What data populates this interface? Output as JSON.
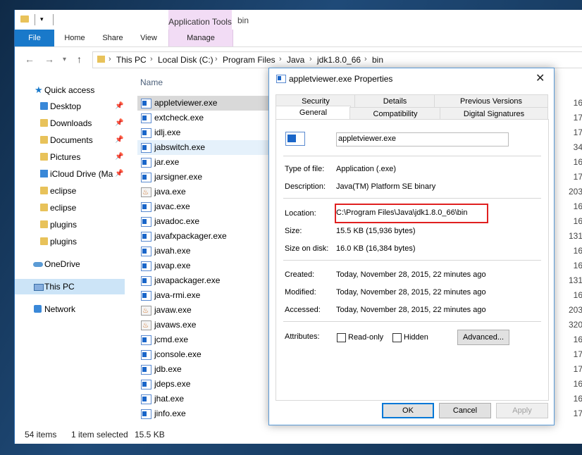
{
  "explorer": {
    "window_title": "bin",
    "ribbon": {
      "context_group": "Application Tools",
      "tabs": [
        "File",
        "Home",
        "Share",
        "View",
        "Manage"
      ]
    },
    "address": [
      "This PC",
      "Local Disk (C:)",
      "Program Files",
      "Java",
      "jdk1.8.0_66",
      "bin"
    ],
    "nav": [
      {
        "label": "Quick access",
        "icon": "star-icon"
      },
      {
        "label": "Desktop",
        "icon": "folder-icon",
        "pinned": true
      },
      {
        "label": "Downloads",
        "icon": "download-folder-icon",
        "pinned": true
      },
      {
        "label": "Documents",
        "icon": "documents-folder-icon",
        "pinned": true
      },
      {
        "label": "Pictures",
        "icon": "pictures-folder-icon",
        "pinned": true
      },
      {
        "label": "iCloud Drive (Ma",
        "icon": "icloud-folder-icon",
        "pinned": true
      },
      {
        "label": "eclipse",
        "icon": "folder-icon"
      },
      {
        "label": "eclipse",
        "icon": "folder-icon"
      },
      {
        "label": "plugins",
        "icon": "folder-icon"
      },
      {
        "label": "plugins",
        "icon": "folder-icon"
      },
      {
        "label": "OneDrive",
        "icon": "cloud-icon"
      },
      {
        "label": "This PC",
        "icon": "computer-icon"
      },
      {
        "label": "Network",
        "icon": "network-icon"
      }
    ],
    "column_header": "Name",
    "files": [
      {
        "name": "appletviewer.exe",
        "size": "16"
      },
      {
        "name": "extcheck.exe",
        "size": "17"
      },
      {
        "name": "idlj.exe",
        "size": "17"
      },
      {
        "name": "jabswitch.exe",
        "size": "34"
      },
      {
        "name": "jar.exe",
        "size": "16"
      },
      {
        "name": "jarsigner.exe",
        "size": "17"
      },
      {
        "name": "java.exe",
        "size": "203"
      },
      {
        "name": "javac.exe",
        "size": "16"
      },
      {
        "name": "javadoc.exe",
        "size": "16"
      },
      {
        "name": "javafxpackager.exe",
        "size": "131"
      },
      {
        "name": "javah.exe",
        "size": "16"
      },
      {
        "name": "javap.exe",
        "size": "16"
      },
      {
        "name": "javapackager.exe",
        "size": "131"
      },
      {
        "name": "java-rmi.exe",
        "size": "16"
      },
      {
        "name": "javaw.exe",
        "size": "203"
      },
      {
        "name": "javaws.exe",
        "size": "320"
      },
      {
        "name": "jcmd.exe",
        "size": "16"
      },
      {
        "name": "jconsole.exe",
        "size": "17"
      },
      {
        "name": "jdb.exe",
        "size": "17"
      },
      {
        "name": "jdeps.exe",
        "size": "16"
      },
      {
        "name": "jhat.exe",
        "size": "16"
      },
      {
        "name": "jinfo.exe",
        "size": "17"
      }
    ],
    "status": {
      "count": "54 items",
      "selected": "1 item selected",
      "size": "15.5 KB"
    }
  },
  "dialog": {
    "title": "appletviewer.exe Properties",
    "tabs_top": [
      "Security",
      "Details",
      "Previous Versions"
    ],
    "tabs_bottom": [
      "General",
      "Compatibility",
      "Digital Signatures"
    ],
    "filename": "appletviewer.exe",
    "rows": {
      "type_label": "Type of file:",
      "type_value": "Application (.exe)",
      "desc_label": "Description:",
      "desc_value": "Java(TM) Platform SE binary",
      "loc_label": "Location:",
      "loc_value": "C:\\Program Files\\Java\\jdk1.8.0_66\\bin",
      "size_label": "Size:",
      "size_value": "15.5 KB (15,936 bytes)",
      "disk_label": "Size on disk:",
      "disk_value": "16.0 KB (16,384 bytes)",
      "created_label": "Created:",
      "created_value": "Today, November 28, 2015, 22 minutes ago",
      "modified_label": "Modified:",
      "modified_value": "Today, November 28, 2015, 22 minutes ago",
      "accessed_label": "Accessed:",
      "accessed_value": "Today, November 28, 2015, 22 minutes ago",
      "attr_label": "Attributes:",
      "readonly": "Read-only",
      "hidden": "Hidden",
      "advanced": "Advanced..."
    },
    "buttons": {
      "ok": "OK",
      "cancel": "Cancel",
      "apply": "Apply"
    }
  }
}
